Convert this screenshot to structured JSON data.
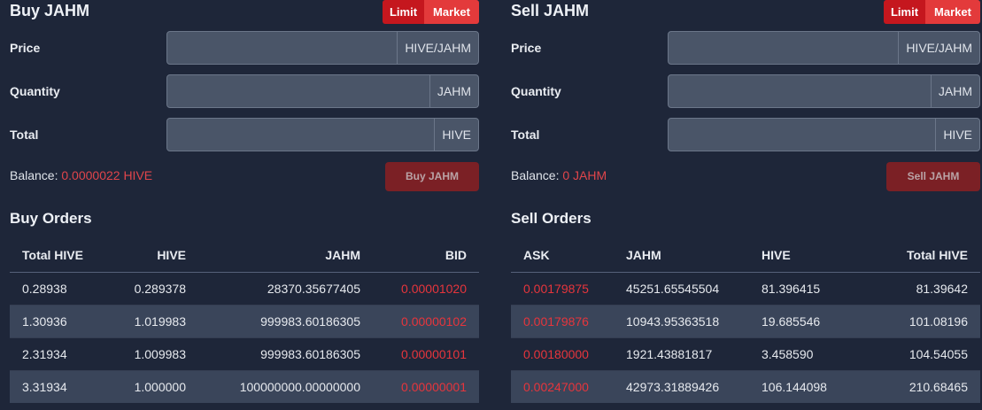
{
  "buy": {
    "title": "Buy JAHM",
    "toggle": {
      "limit": "Limit",
      "market": "Market"
    },
    "fields": {
      "price": {
        "label": "Price",
        "value": "",
        "unit": "HIVE/JAHM"
      },
      "quantity": {
        "label": "Quantity",
        "value": "",
        "unit": "JAHM"
      },
      "total": {
        "label": "Total",
        "value": "",
        "unit": "HIVE"
      }
    },
    "balance_label": "Balance:",
    "balance_value": "0.0000022 HIVE",
    "button": "Buy JAHM",
    "orders_title": "Buy Orders",
    "columns": [
      "Total HIVE",
      "HIVE",
      "JAHM",
      "BID"
    ],
    "rows": [
      [
        "0.28938",
        "0.289378",
        "28370.35677405",
        "0.00001020"
      ],
      [
        "1.30936",
        "1.019983",
        "999983.60186305",
        "0.00000102"
      ],
      [
        "2.31934",
        "1.009983",
        "999983.60186305",
        "0.00000101"
      ],
      [
        "3.31934",
        "1.000000",
        "100000000.00000000",
        "0.00000001"
      ]
    ]
  },
  "sell": {
    "title": "Sell JAHM",
    "toggle": {
      "limit": "Limit",
      "market": "Market"
    },
    "fields": {
      "price": {
        "label": "Price",
        "value": "",
        "unit": "HIVE/JAHM"
      },
      "quantity": {
        "label": "Quantity",
        "value": "",
        "unit": "JAHM"
      },
      "total": {
        "label": "Total",
        "value": "",
        "unit": "HIVE"
      }
    },
    "balance_label": "Balance:",
    "balance_value": "0 JAHM",
    "button": "Sell JAHM",
    "orders_title": "Sell Orders",
    "columns": [
      "ASK",
      "JAHM",
      "HIVE",
      "Total HIVE"
    ],
    "rows": [
      [
        "0.00179875",
        "45251.65545504",
        "81.396415",
        "81.39642"
      ],
      [
        "0.00179876",
        "10943.95363518",
        "19.685546",
        "101.08196"
      ],
      [
        "0.00180000",
        "1921.43881817",
        "3.458590",
        "104.54055"
      ],
      [
        "0.00247000",
        "42973.31889426",
        "106.144098",
        "210.68465"
      ]
    ]
  },
  "colors": {
    "background": "#1e2639",
    "accent_red": "#e6353c",
    "limit_active": "#c5171e",
    "market_bg": "#e33a3b",
    "disabled_button": "#7b2025"
  }
}
